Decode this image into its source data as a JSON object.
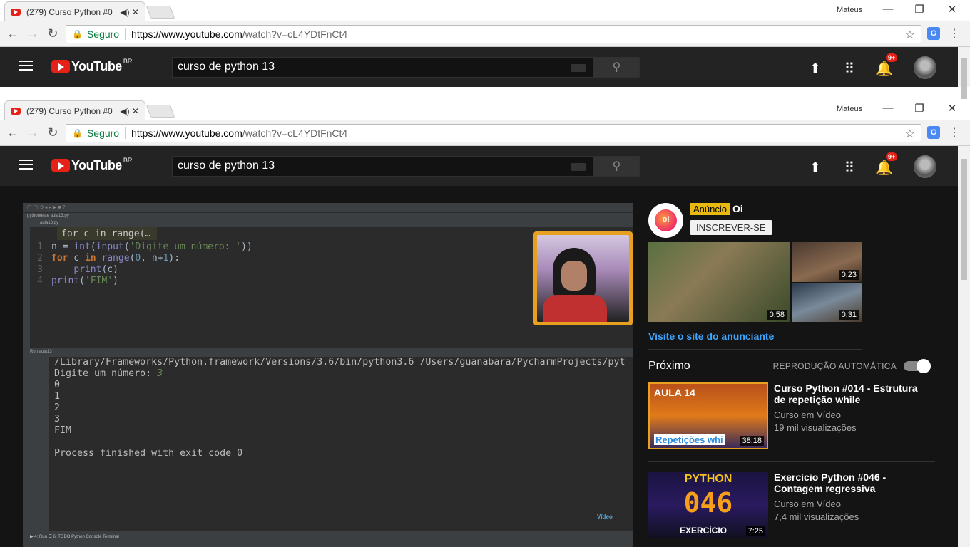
{
  "browser": {
    "tab_title": "(279) Curso Python #0",
    "tab_icons": "◀) ✕",
    "user": "Mateus",
    "secure_label": "Seguro",
    "url_host": "https://www.youtube.com",
    "url_path": "/watch?v=cL4YDtFnCt4"
  },
  "youtube": {
    "logo_text": "YouTube",
    "region": "BR",
    "search_value": "curso de python 13",
    "notification_count": "9+"
  },
  "ide": {
    "toolbar_text": "pythonteste  aula13.py",
    "tab_text": "aula13.py",
    "fold_text": "for c in range(…",
    "code_lines": [
      {
        "num": "1",
        "parts": [
          [
            "",
            "n = "
          ],
          [
            "bi",
            "int"
          ],
          [
            "",
            "("
          ],
          [
            "bi",
            "input"
          ],
          [
            "",
            "("
          ],
          [
            "str",
            "'Digite um número: '"
          ],
          [
            "",
            "))"
          ]
        ]
      },
      {
        "num": "2",
        "parts": [
          [
            "kw",
            "for"
          ],
          [
            "",
            " c "
          ],
          [
            "kw",
            "in"
          ],
          [
            "",
            " "
          ],
          [
            "bi",
            "range"
          ],
          [
            "",
            "("
          ],
          [
            "nm",
            "0"
          ],
          [
            "",
            ", n+"
          ],
          [
            "nm",
            "1"
          ],
          [
            "",
            "):"
          ]
        ]
      },
      {
        "num": "3",
        "parts": [
          [
            "",
            "    "
          ],
          [
            "bi",
            "print"
          ],
          [
            "",
            "(c)"
          ]
        ]
      },
      {
        "num": "4",
        "parts": [
          [
            "bi",
            "print"
          ],
          [
            "",
            "("
          ],
          [
            "str",
            "'FIM'"
          ],
          [
            "",
            ")"
          ]
        ]
      }
    ],
    "run_header": "Run  aula13",
    "console": {
      "cmd": "/Library/Frameworks/Python.framework/Versions/3.6/bin/python3.6 /Users/guanabara/PycharmProjects/pyt",
      "prompt": "Digite um número: ",
      "input": "3",
      "out": [
        "0",
        "1",
        "2",
        "3",
        "FIM",
        "",
        "Process finished with exit code 0"
      ]
    },
    "status_text": "▶ 4: Run   ☰ 6: TODO   Python Console   Terminal",
    "watermark": "Vídeo"
  },
  "sidebar": {
    "ad_badge": "Anúncio",
    "ad_name": "Oi",
    "ad_logo": "oi",
    "subscribe_label": "INSCREVER-SE",
    "ad_durations": [
      "0:58",
      "0:23",
      "0:31"
    ],
    "visit_label": "Visite o site do anunciante",
    "next_label": "Próximo",
    "autoplay_label": "REPRODUÇÃO AUTOMÁTICA",
    "recommendations": [
      {
        "title": "Curso Python #014 - Estrutura de repetição while",
        "channel": "Curso em Vídeo",
        "views": "19 mil visualizações",
        "duration": "38:18",
        "thumb_top": "AULA 14",
        "thumb_bottom": "Repetições whi"
      },
      {
        "title": "Exercício Python #046 - Contagem regressiva",
        "channel": "Curso em Vídeo",
        "views": "7,4 mil visualizações",
        "duration": "7:25",
        "thumb_top": "PYTHON",
        "thumb_num": "046",
        "thumb_bottom": "EXERCÍCIO"
      }
    ]
  }
}
